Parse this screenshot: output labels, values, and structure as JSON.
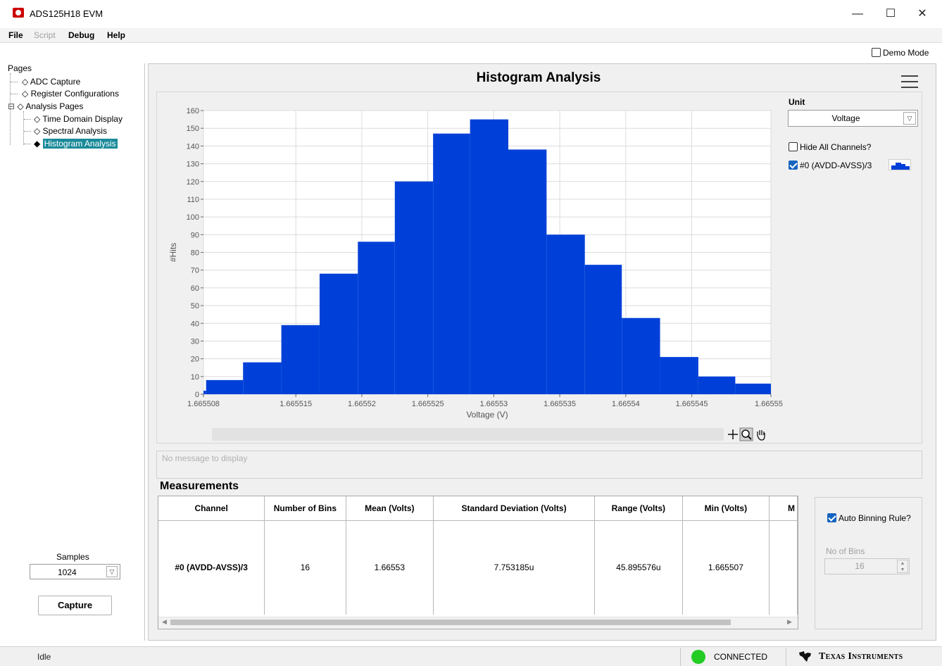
{
  "window": {
    "title": "ADS125H18 EVM",
    "minimize": "—",
    "maximize": "☐",
    "close": "✕"
  },
  "menu": {
    "file": "File",
    "script": "Script",
    "debug": "Debug",
    "help": "Help"
  },
  "demo_mode": {
    "label": "Demo Mode",
    "checked": false
  },
  "nav": {
    "heading": "Pages",
    "items": [
      {
        "label": "ADC Capture",
        "icon": "diamond-outline-icon"
      },
      {
        "label": "Register Configurations",
        "icon": "diamond-outline-icon"
      },
      {
        "label": "Analysis Pages",
        "icon": "diamond-outline-icon",
        "expander": "⊟"
      },
      {
        "label": "Time Domain Display",
        "icon": "diamond-outline-icon"
      },
      {
        "label": "Spectral Analysis",
        "icon": "diamond-outline-icon"
      },
      {
        "label": "Histogram Analysis",
        "icon": "diamond-filled-icon",
        "selected": true
      }
    ]
  },
  "samples": {
    "label": "Samples",
    "value": "1024"
  },
  "capture": {
    "label": "Capture"
  },
  "page": {
    "title": "Histogram Analysis"
  },
  "unit": {
    "label": "Unit",
    "value": "Voltage"
  },
  "hide_all": {
    "label": "Hide All Channels?",
    "checked": false
  },
  "channel": {
    "label": "#0 (AVDD-AVSS)/3",
    "checked": true,
    "color": "#0040d8"
  },
  "chart_data": {
    "type": "bar",
    "xlabel": "Voltage (V)",
    "ylabel": "#Hits",
    "ylim": [
      0,
      160
    ],
    "yticks": [
      0,
      10,
      20,
      30,
      40,
      50,
      60,
      70,
      80,
      90,
      100,
      110,
      120,
      130,
      140,
      150,
      160
    ],
    "xlim": [
      1.665508,
      1.665551
    ],
    "xtick_values": [
      1.665508,
      1.665515,
      1.66552,
      1.665525,
      1.66553,
      1.665535,
      1.66554,
      1.665545,
      1.665551
    ],
    "xtick_labels": [
      "1.665508",
      "1.665515",
      "1.66552",
      "1.665525",
      "1.66553",
      "1.665535",
      "1.66554",
      "1.665545",
      "1.665551"
    ],
    "grid": true,
    "bar_color": "#0040d8",
    "series": [
      {
        "name": "#0 (AVDD-AVSS)/3",
        "bin_starts": [
          1.6655067,
          1.6655082,
          1.665511,
          1.6655139,
          1.6655168,
          1.6655197,
          1.6655225,
          1.6655254,
          1.6655282,
          1.6655311,
          1.665534,
          1.6655369,
          1.6655397,
          1.6655426,
          1.6655455,
          1.6655483
        ],
        "bin_ends": [
          1.6655082,
          1.665511,
          1.6655139,
          1.6655168,
          1.6655197,
          1.6655225,
          1.6655254,
          1.6655282,
          1.6655311,
          1.665534,
          1.6655369,
          1.6655397,
          1.6655426,
          1.6655455,
          1.6655483,
          1.665551
        ],
        "values": [
          2,
          8,
          18,
          39,
          68,
          86,
          120,
          147,
          155,
          138,
          90,
          73,
          43,
          21,
          10,
          6
        ]
      }
    ]
  },
  "message": {
    "text": "No message to display"
  },
  "measurements": {
    "title": "Measurements",
    "columns": [
      "Channel",
      "Number of Bins",
      "Mean (Volts)",
      "Standard Deviation (Volts)",
      "Range (Volts)",
      "Min (Volts)",
      "M"
    ],
    "rows": [
      [
        "#0 (AVDD-AVSS)/3",
        "16",
        "1.66553",
        "7.753185u",
        "45.895576u",
        "1.665507",
        ""
      ]
    ]
  },
  "binning": {
    "auto_label": "Auto Binning Rule?",
    "auto_checked": true,
    "bins_label": "No of Bins",
    "bins_value": "16"
  },
  "status": {
    "text": "Idle",
    "connection": "CONNECTED",
    "connection_color": "#22cc22",
    "brand": "Texas Instruments"
  }
}
